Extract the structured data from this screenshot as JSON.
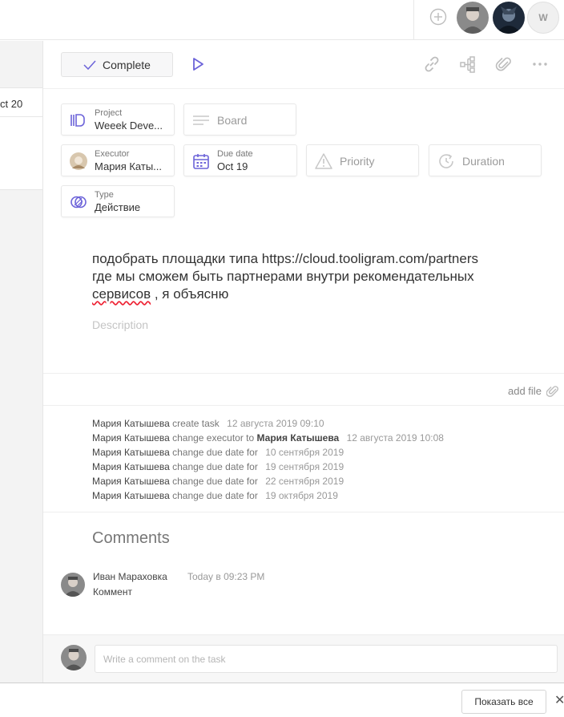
{
  "topbar": {
    "user_initial": "W"
  },
  "left_panel": {
    "card_label": "ct 20"
  },
  "toolbar": {
    "complete_label": "Complete"
  },
  "fields": {
    "project": {
      "label": "Project",
      "value": "Weeek Deve..."
    },
    "board": {
      "placeholder": "Board"
    },
    "executor": {
      "label": "Executor",
      "value": "Мария Каты..."
    },
    "due_date": {
      "label": "Due date",
      "value": "Oct 19"
    },
    "priority": {
      "placeholder": "Priority"
    },
    "duration": {
      "placeholder": "Duration"
    },
    "type": {
      "label": "Type",
      "value": "Действие"
    }
  },
  "description": {
    "line1": "подобрать площадки типа https://cloud.tooligram.com/partners",
    "line2": "где мы сможем быть партнерами внутри рекомендательных",
    "line3_word": "сервисов",
    "line3_rest": " , я объясню",
    "placeholder": "Description"
  },
  "attachments": {
    "add_file_label": "add file"
  },
  "activity": [
    {
      "who": "Мария Катышева",
      "action": "create task",
      "target": "",
      "date": "12 августа 2019 09:10"
    },
    {
      "who": "Мария Катышева",
      "action": "change executor to",
      "target": "Мария Катышева",
      "date": "12 августа 2019 10:08"
    },
    {
      "who": "Мария Катышева",
      "action": "change due date for",
      "target": "",
      "date": "10 сентября 2019"
    },
    {
      "who": "Мария Катышева",
      "action": "change due date for",
      "target": "",
      "date": "19 сентября 2019"
    },
    {
      "who": "Мария Катышева",
      "action": "change due date for",
      "target": "",
      "date": "22 сентября 2019"
    },
    {
      "who": "Мария Катышева",
      "action": "change due date for",
      "target": "",
      "date": "19 октября 2019"
    }
  ],
  "comments": {
    "title": "Comments",
    "items": [
      {
        "author": "Иван Мараховка",
        "time": "Today в 09:23 PM",
        "text": "Коммент"
      }
    ],
    "input_placeholder": "Write a comment on the task"
  },
  "download_bar": {
    "show_all_label": "Показать все",
    "close_glyph": "✕"
  },
  "colors": {
    "accent": "#6c63d9",
    "icon_gray": "#b8b8b8"
  }
}
